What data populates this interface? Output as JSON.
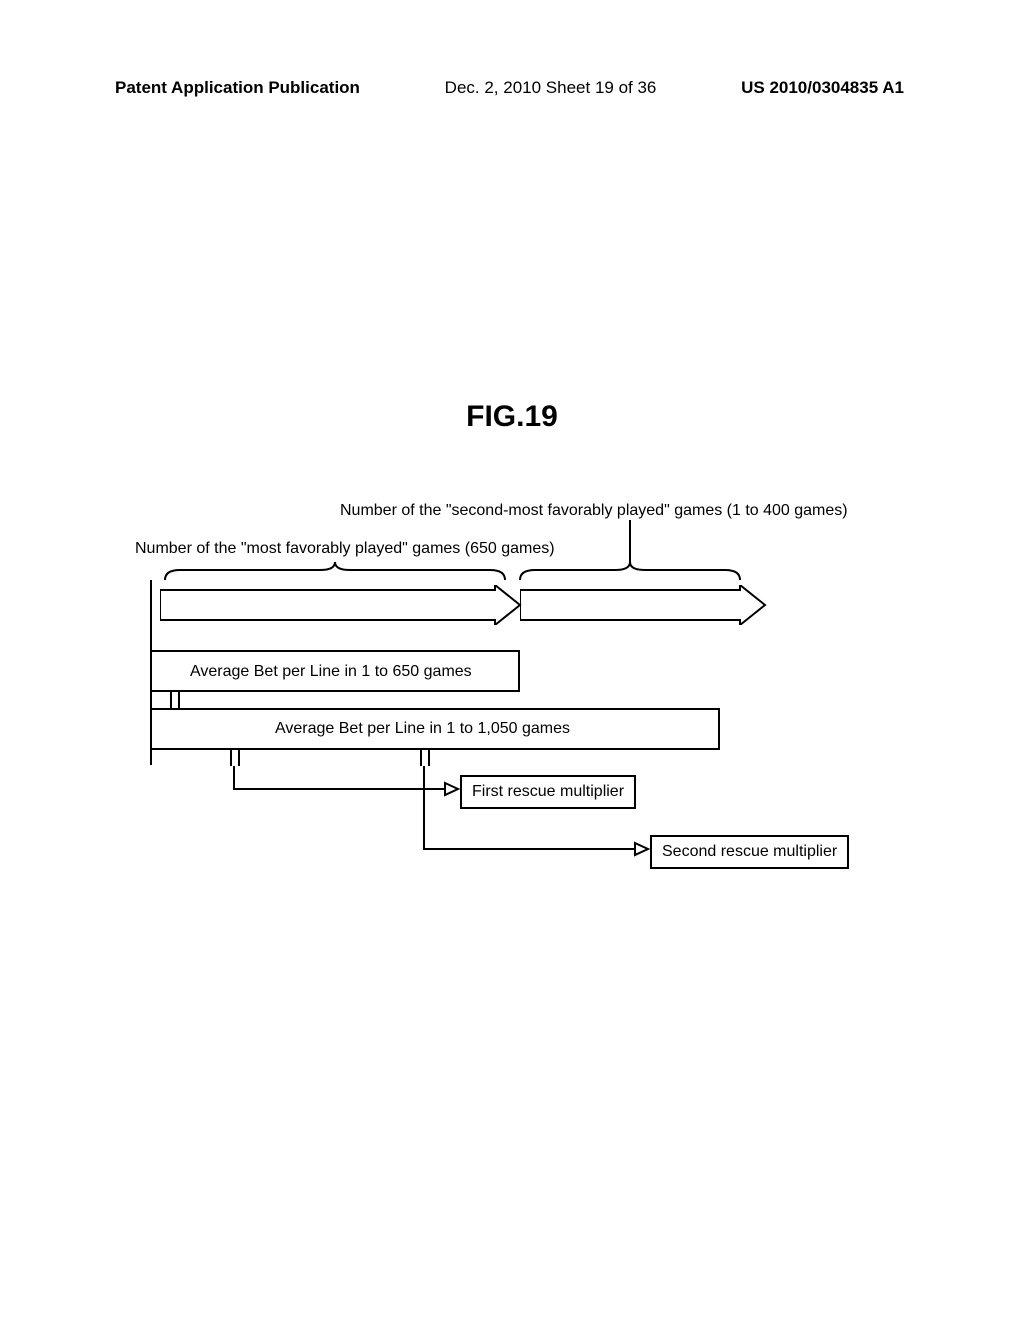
{
  "header": {
    "left": "Patent Application Publication",
    "mid": "Dec. 2, 2010   Sheet 19 of 36",
    "right": "US 2010/0304835 A1"
  },
  "figure": {
    "title": "FIG.19",
    "label_second_most": "Number of the \"second-most favorably played\" games (1 to 400 games)",
    "label_most": "Number of the \"most favorably played\" games (650 games)",
    "avg_650": "Average Bet per Line in 1 to 650 games",
    "avg_1050": "Average Bet per Line in 1 to 1,050 games",
    "first_rescue": "First rescue multiplier",
    "second_rescue": "Second rescue multiplier"
  },
  "chart_data": {
    "type": "table",
    "title": "FIG.19",
    "segments": [
      {
        "name": "most favorably played",
        "games": 650
      },
      {
        "name": "second-most favorably played",
        "games_min": 1,
        "games_max": 400
      }
    ],
    "averages": [
      {
        "label": "Average Bet per Line in 1 to 650 games",
        "range": [
          1,
          650
        ],
        "maps_to": "First rescue multiplier"
      },
      {
        "label": "Average Bet per Line in 1 to 1,050 games",
        "range": [
          1,
          1050
        ],
        "maps_to": "Second rescue multiplier"
      }
    ],
    "multipliers": [
      "First rescue multiplier",
      "Second rescue multiplier"
    ]
  }
}
